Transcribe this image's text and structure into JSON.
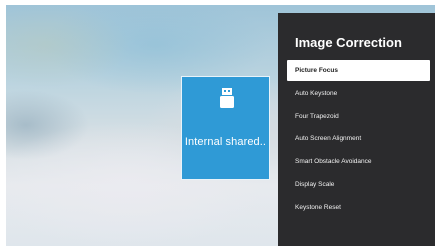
{
  "storage_tile": {
    "label": "Internal shared..",
    "icon": "usb-drive-icon"
  },
  "panel": {
    "title": "Image Correction",
    "items": [
      {
        "label": "Picture Focus",
        "selected": true
      },
      {
        "label": "Auto Keystone",
        "selected": false
      },
      {
        "label": "Four Trapezoid",
        "selected": false
      },
      {
        "label": "Auto Screen Alignment",
        "selected": false
      },
      {
        "label": "Smart Obstacle Avoidance",
        "selected": false
      },
      {
        "label": "Display Scale",
        "selected": false
      },
      {
        "label": "Keystone Reset",
        "selected": false
      }
    ]
  },
  "colors": {
    "tile_bg": "#2f9ad6",
    "panel_bg": "#2b2b2d",
    "selected_bg": "#ffffff"
  }
}
